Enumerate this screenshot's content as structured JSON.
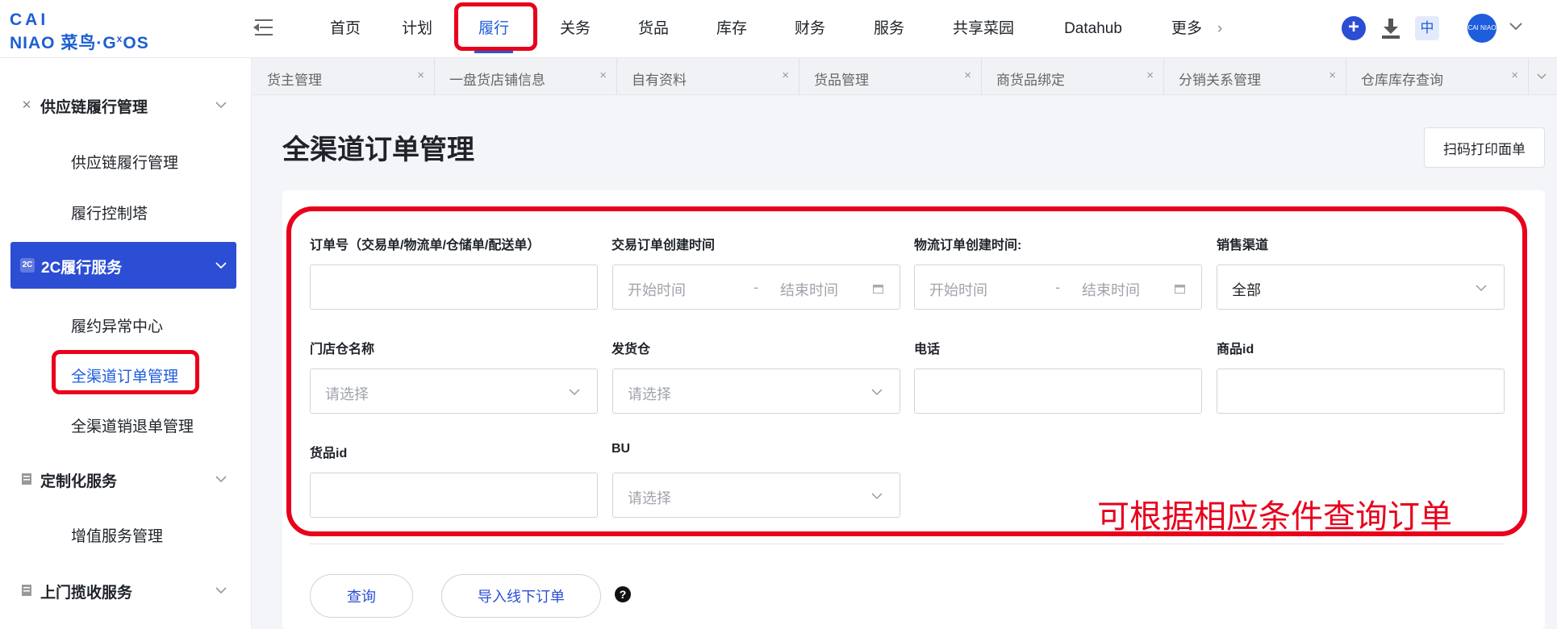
{
  "header": {
    "logo_line1": "CAI",
    "logo_line2": "NIAO 菜鸟·G",
    "logo_sup": "x",
    "logo_tail": "OS",
    "nav": [
      "首页",
      "计划",
      "履行",
      "关务",
      "货品",
      "库存",
      "财务",
      "服务",
      "共享菜园",
      "Datahub",
      "更多"
    ],
    "nav_more_arrow": "›",
    "active_nav": "履行",
    "lang": "中",
    "avatar_text": "CAI NIAO"
  },
  "sidebar": {
    "groups": [
      {
        "label": "供应链履行管理",
        "icon": "network-icon",
        "subs": [
          "供应链履行管理",
          "履行控制塔"
        ]
      },
      {
        "label": "2C履行服务",
        "icon": "2c-icon",
        "icon_text": "2C",
        "subs": [
          "履约异常中心",
          "全渠道订单管理",
          "全渠道销退单管理"
        ]
      },
      {
        "label": "定制化服务",
        "icon": "doc-icon",
        "subs": [
          "增值服务管理"
        ]
      },
      {
        "label": "上门揽收服务",
        "icon": "doc-icon",
        "subs": []
      }
    ],
    "active_sub": "全渠道订单管理"
  },
  "tabs": [
    "货主管理",
    "一盘货店铺信息",
    "自有资料",
    "货品管理",
    "商货品绑定",
    "分销关系管理",
    "仓库库存查询"
  ],
  "tab_close": "×",
  "main": {
    "title": "全渠道订单管理",
    "print_button": "扫码打印面单",
    "form": {
      "order_no_label": "订单号（交易单/物流单/仓储单/配送单）",
      "trade_time_label": "交易订单创建时间",
      "logistics_time_label": "物流订单创建时间:",
      "channel_label": "销售渠道",
      "start_placeholder": "开始时间",
      "end_placeholder": "结束时间",
      "range_sep": "-",
      "channel_value": "全部",
      "store_label": "门店仓名称",
      "ship_wh_label": "发货仓",
      "phone_label": "电话",
      "product_id_label": "商品id",
      "goods_id_label": "货品id",
      "bu_label": "BU",
      "select_placeholder": "请选择"
    },
    "query_button": "查询",
    "import_button": "导入线下订单",
    "help": "?"
  },
  "annotation": "可根据相应条件查询订单",
  "colors": {
    "primary": "#2c4ed4",
    "highlight": "#e8001c",
    "link": "#1e5ddc"
  }
}
